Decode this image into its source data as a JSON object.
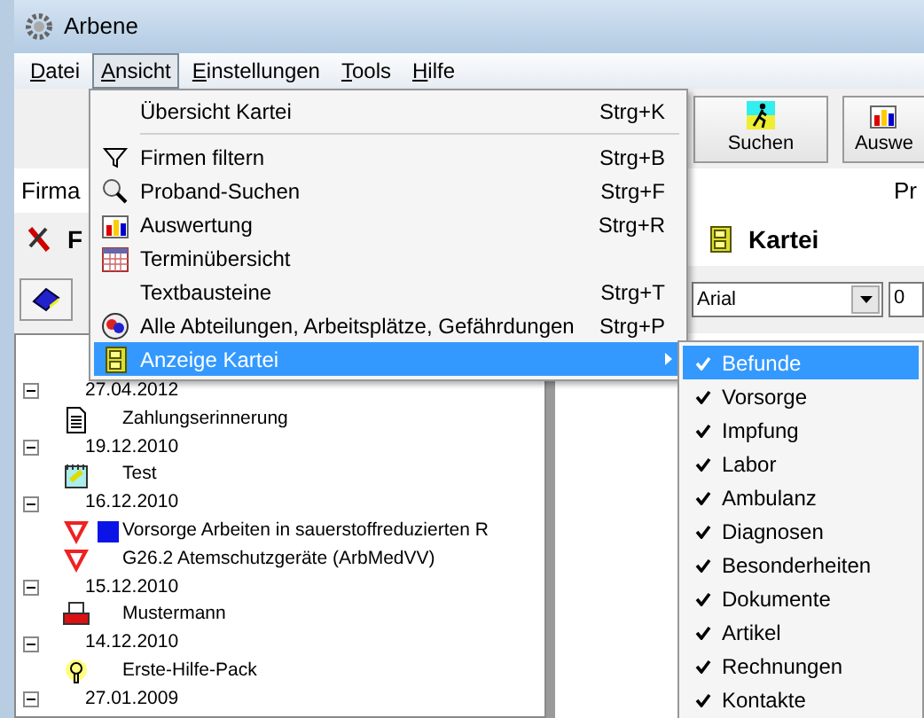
{
  "window": {
    "title": "Arbene"
  },
  "menu_bar": [
    {
      "label": "Datei",
      "selected": false
    },
    {
      "label": "Ansicht",
      "selected": true
    },
    {
      "label": "Einstellungen",
      "selected": false
    },
    {
      "label": "Tools",
      "selected": false
    },
    {
      "label": "Hilfe",
      "selected": false
    }
  ],
  "toolbar": {
    "buttons": [
      {
        "label": "Suchen"
      },
      {
        "label": "Auswe"
      }
    ]
  },
  "info_row": {
    "column_1": "Firma",
    "column_2": "Pr"
  },
  "panels": {
    "left_title": "F",
    "right_title": "Kartei"
  },
  "format_bar": {
    "font": "Arial",
    "size": "0"
  },
  "tree": [
    {
      "label": "27.04.2012",
      "expanded": true,
      "children": [
        {
          "label": "Zahlungserinnerung"
        }
      ]
    },
    {
      "label": "19.12.2010",
      "expanded": true,
      "children": [
        {
          "label": "Test"
        }
      ]
    },
    {
      "label": "16.12.2010",
      "expanded": true,
      "children": [
        {
          "label": "Vorsorge Arbeiten in sauerstoffreduzierten R"
        },
        {
          "label": "G26.2 Atemschutzgeräte (ArbMedVV)"
        }
      ]
    },
    {
      "label": "15.12.2010",
      "expanded": true,
      "children": [
        {
          "label": "Mustermann"
        }
      ]
    },
    {
      "label": "14.12.2010",
      "expanded": true,
      "children": [
        {
          "label": "Erste-Hilfe-Pack"
        }
      ]
    },
    {
      "label": "27.01.2009",
      "expanded": true
    }
  ],
  "menu": {
    "items": [
      {
        "kind": "item",
        "label": "Übersicht Kartei",
        "shortcut": "Strg+K",
        "selected": false
      },
      {
        "kind": "separator"
      },
      {
        "kind": "item",
        "label": "Firmen filtern",
        "shortcut": "Strg+B",
        "selected": false
      },
      {
        "kind": "item",
        "label": "Proband-Suchen",
        "shortcut": "Strg+F",
        "selected": false
      },
      {
        "kind": "item",
        "label": "Auswertung",
        "shortcut": "Strg+R",
        "selected": false
      },
      {
        "kind": "item",
        "label": "Terminübersicht",
        "selected": false
      },
      {
        "kind": "item",
        "label": "Textbausteine",
        "shortcut": "Strg+T",
        "selected": false
      },
      {
        "kind": "item",
        "label": "Alle Abteilungen, Arbeitsplätze, Gefährdungen",
        "shortcut": "Strg+P",
        "selected": false
      },
      {
        "kind": "submenu",
        "label": "Anzeige Kartei",
        "selected": true
      }
    ]
  },
  "submenu": {
    "items": [
      {
        "label": "Befunde",
        "checked": true,
        "selected": true
      },
      {
        "label": "Vorsorge",
        "checked": true,
        "selected": false
      },
      {
        "label": "Impfung",
        "checked": true,
        "selected": false
      },
      {
        "label": "Labor",
        "checked": true,
        "selected": false
      },
      {
        "label": "Ambulanz",
        "checked": true,
        "selected": false
      },
      {
        "label": "Diagnosen",
        "checked": true,
        "selected": false
      },
      {
        "label": "Besonderheiten",
        "checked": true,
        "selected": false
      },
      {
        "label": "Dokumente",
        "checked": true,
        "selected": false
      },
      {
        "label": "Artikel",
        "checked": true,
        "selected": false
      },
      {
        "label": "Rechnungen",
        "checked": true,
        "selected": false
      },
      {
        "label": "Kontakte",
        "checked": true,
        "selected": false
      }
    ]
  }
}
